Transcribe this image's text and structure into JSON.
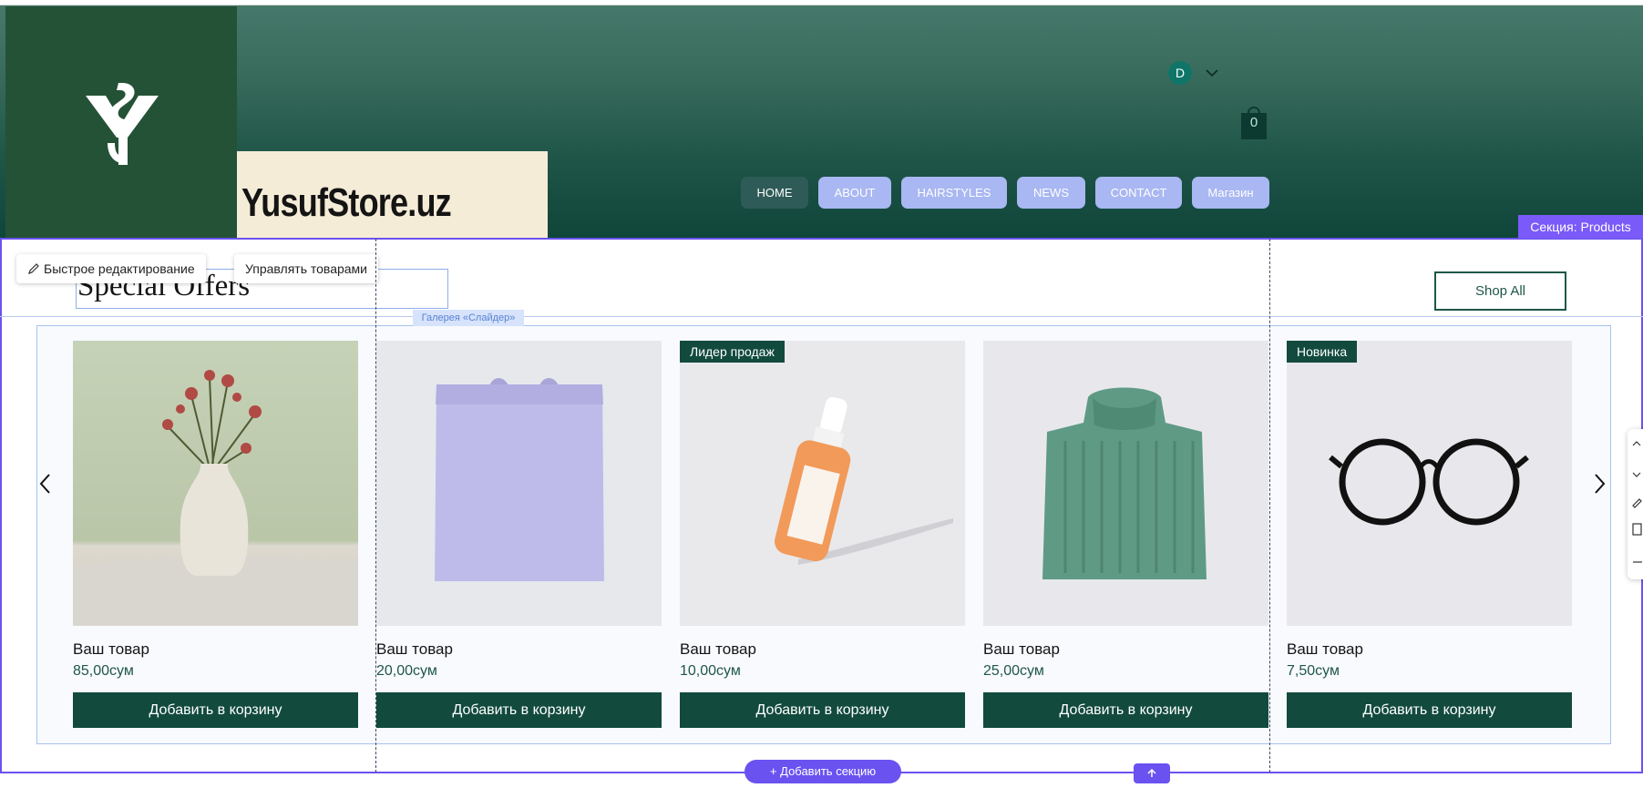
{
  "header": {
    "brand_name": "YusufStore.uz",
    "user_initial": "D",
    "cart_count": "0",
    "nav": [
      "HOME",
      "ABOUT",
      "HAIRSTYLES",
      "NEWS",
      "CONTACT",
      "Магазин"
    ],
    "active_nav": "HOME"
  },
  "editor": {
    "section_label": "Секция: Products",
    "quick_edit_label": "Быстрое редактирование",
    "manage_products_label": "Управлять товарами",
    "gallery_label": "Галерея «Слайдер»",
    "add_section_label": "+ Добавить секцию"
  },
  "products_section": {
    "title": "Special Offers",
    "shop_all_label": "Shop All",
    "products": [
      {
        "name": "Ваш товар",
        "price": "85,00сум",
        "button": "Добавить в корзину",
        "badge": "",
        "image": "vase-with-dried-roses"
      },
      {
        "name": "Ваш товар",
        "price": "20,00сум",
        "button": "Добавить в корзину",
        "badge": "",
        "image": "lavender-tote-bag"
      },
      {
        "name": "Ваш товар",
        "price": "10,00сум",
        "button": "Добавить в корзину",
        "badge": "Лидер продаж",
        "image": "orange-serum-bottle"
      },
      {
        "name": "Ваш товар",
        "price": "25,00сум",
        "button": "Добавить в корзину",
        "badge": "",
        "image": "green-knit-sweater"
      },
      {
        "name": "Ваш товар",
        "price": "7,50сум",
        "button": "Добавить в корзину",
        "badge": "Новинка",
        "image": "black-eyeglasses"
      }
    ]
  },
  "colors": {
    "brand_green": "#124b3e",
    "nav_button": "#a9b7f2",
    "editor_accent": "#6a52f0"
  }
}
